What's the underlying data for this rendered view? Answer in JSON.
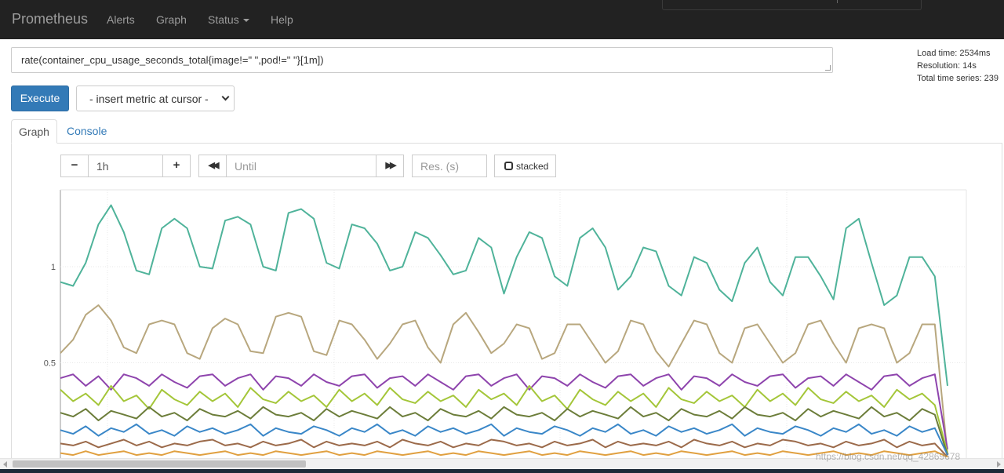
{
  "navbar": {
    "brand": "Prometheus",
    "links": [
      {
        "label": "Alerts"
      },
      {
        "label": "Graph"
      },
      {
        "label": "Status"
      },
      {
        "label": "Help"
      }
    ]
  },
  "query": {
    "expression": "rate(container_cpu_usage_seconds_total{image!=\" \",pod!=\" \"}[1m])"
  },
  "stats": {
    "load_time": "Load time: 2534ms",
    "resolution": "Resolution: 14s",
    "total_series": "Total time series: 239"
  },
  "actions": {
    "execute_label": "Execute",
    "insert_metric_label": "- insert metric at cursor -"
  },
  "tabs": [
    {
      "label": "Graph",
      "active": true
    },
    {
      "label": "Console",
      "active": false
    }
  ],
  "graph_controls": {
    "range_decrease": "−",
    "range_value": "1h",
    "range_increase": "+",
    "back": "◀◀",
    "until_placeholder": "Until",
    "forward": "▶▶",
    "resolution_placeholder": "Res. (s)",
    "stacked_label": "stacked"
  },
  "watermark": "https://blog.csdn.net/qq_42869678",
  "chart_data": {
    "type": "line",
    "ylim": [
      0,
      1.4
    ],
    "y_ticks": [
      {
        "value": 0.5,
        "label": "0.5"
      },
      {
        "value": 1,
        "label": "1"
      }
    ],
    "grid": true,
    "series_count_shown": 239,
    "colors": [
      "#4fb39a",
      "#b8a77e",
      "#8e44ad",
      "#a4c639",
      "#6c7d3a",
      "#3a87c8",
      "#9b6a4a",
      "#e0a040"
    ],
    "series": [
      {
        "values": [
          0.92,
          0.9,
          1.02,
          1.22,
          1.32,
          1.18,
          0.98,
          0.96,
          1.2,
          1.25,
          1.2,
          1.0,
          0.99,
          1.24,
          1.26,
          1.22,
          1.0,
          0.98,
          1.28,
          1.3,
          1.25,
          1.02,
          0.99,
          1.22,
          1.2,
          1.12,
          0.98,
          1.0,
          1.18,
          1.15,
          1.06,
          0.96,
          0.98,
          1.15,
          1.1,
          0.86,
          1.05,
          1.18,
          1.15,
          0.95,
          0.9,
          1.15,
          1.2,
          1.1,
          0.88,
          0.95,
          1.1,
          1.08,
          0.9,
          0.85,
          1.05,
          1.02,
          0.88,
          0.82,
          1.02,
          1.1,
          0.92,
          0.85,
          1.05,
          1.05,
          0.95,
          0.83,
          1.2,
          1.25,
          1.02,
          0.8,
          0.85,
          1.05,
          1.05,
          0.95,
          0.38
        ]
      },
      {
        "values": [
          0.55,
          0.62,
          0.75,
          0.8,
          0.72,
          0.58,
          0.55,
          0.7,
          0.72,
          0.7,
          0.55,
          0.52,
          0.68,
          0.73,
          0.7,
          0.56,
          0.55,
          0.74,
          0.76,
          0.74,
          0.56,
          0.54,
          0.72,
          0.7,
          0.62,
          0.52,
          0.6,
          0.7,
          0.72,
          0.58,
          0.5,
          0.7,
          0.76,
          0.66,
          0.55,
          0.6,
          0.7,
          0.68,
          0.52,
          0.55,
          0.7,
          0.7,
          0.6,
          0.5,
          0.56,
          0.72,
          0.7,
          0.56,
          0.48,
          0.6,
          0.72,
          0.7,
          0.55,
          0.5,
          0.68,
          0.7,
          0.6,
          0.5,
          0.55,
          0.7,
          0.72,
          0.6,
          0.5,
          0.68,
          0.7,
          0.68,
          0.5,
          0.55,
          0.7,
          0.7,
          0.02
        ]
      },
      {
        "values": [
          0.42,
          0.44,
          0.38,
          0.43,
          0.36,
          0.44,
          0.42,
          0.38,
          0.44,
          0.4,
          0.37,
          0.43,
          0.44,
          0.38,
          0.42,
          0.44,
          0.36,
          0.43,
          0.42,
          0.38,
          0.44,
          0.4,
          0.38,
          0.43,
          0.44,
          0.37,
          0.42,
          0.43,
          0.38,
          0.44,
          0.4,
          0.36,
          0.43,
          0.44,
          0.38,
          0.42,
          0.44,
          0.36,
          0.43,
          0.42,
          0.38,
          0.44,
          0.4,
          0.37,
          0.43,
          0.44,
          0.38,
          0.42,
          0.44,
          0.36,
          0.43,
          0.42,
          0.38,
          0.44,
          0.4,
          0.38,
          0.43,
          0.44,
          0.37,
          0.42,
          0.43,
          0.38,
          0.44,
          0.4,
          0.36,
          0.43,
          0.44,
          0.38,
          0.42,
          0.44,
          0.05
        ]
      },
      {
        "values": [
          0.36,
          0.3,
          0.34,
          0.28,
          0.38,
          0.3,
          0.33,
          0.26,
          0.36,
          0.31,
          0.28,
          0.35,
          0.3,
          0.34,
          0.27,
          0.37,
          0.31,
          0.29,
          0.35,
          0.3,
          0.33,
          0.27,
          0.36,
          0.3,
          0.34,
          0.28,
          0.37,
          0.31,
          0.29,
          0.35,
          0.3,
          0.33,
          0.27,
          0.36,
          0.31,
          0.34,
          0.28,
          0.38,
          0.3,
          0.33,
          0.26,
          0.36,
          0.31,
          0.28,
          0.35,
          0.3,
          0.34,
          0.27,
          0.37,
          0.31,
          0.29,
          0.35,
          0.3,
          0.33,
          0.27,
          0.36,
          0.3,
          0.34,
          0.28,
          0.37,
          0.31,
          0.29,
          0.35,
          0.3,
          0.33,
          0.27,
          0.36,
          0.31,
          0.34,
          0.28,
          0.03
        ]
      },
      {
        "values": [
          0.24,
          0.22,
          0.26,
          0.2,
          0.25,
          0.23,
          0.21,
          0.27,
          0.22,
          0.24,
          0.2,
          0.26,
          0.23,
          0.22,
          0.25,
          0.21,
          0.27,
          0.23,
          0.22,
          0.24,
          0.2,
          0.26,
          0.22,
          0.25,
          0.23,
          0.21,
          0.27,
          0.22,
          0.24,
          0.2,
          0.26,
          0.23,
          0.22,
          0.25,
          0.21,
          0.27,
          0.23,
          0.22,
          0.24,
          0.2,
          0.26,
          0.22,
          0.25,
          0.23,
          0.21,
          0.27,
          0.22,
          0.24,
          0.2,
          0.26,
          0.23,
          0.22,
          0.25,
          0.21,
          0.27,
          0.23,
          0.22,
          0.24,
          0.2,
          0.26,
          0.22,
          0.25,
          0.23,
          0.21,
          0.27,
          0.22,
          0.24,
          0.2,
          0.26,
          0.23,
          0.02
        ]
      },
      {
        "values": [
          0.15,
          0.13,
          0.17,
          0.12,
          0.16,
          0.14,
          0.18,
          0.13,
          0.15,
          0.12,
          0.17,
          0.14,
          0.16,
          0.13,
          0.15,
          0.18,
          0.12,
          0.16,
          0.14,
          0.13,
          0.17,
          0.15,
          0.12,
          0.16,
          0.14,
          0.18,
          0.13,
          0.15,
          0.12,
          0.17,
          0.14,
          0.16,
          0.13,
          0.15,
          0.18,
          0.12,
          0.16,
          0.14,
          0.13,
          0.17,
          0.15,
          0.12,
          0.16,
          0.14,
          0.18,
          0.13,
          0.15,
          0.12,
          0.17,
          0.14,
          0.16,
          0.13,
          0.15,
          0.18,
          0.12,
          0.16,
          0.14,
          0.13,
          0.17,
          0.15,
          0.12,
          0.16,
          0.14,
          0.18,
          0.13,
          0.15,
          0.12,
          0.17,
          0.14,
          0.16,
          0.02
        ]
      },
      {
        "values": [
          0.08,
          0.07,
          0.09,
          0.06,
          0.08,
          0.1,
          0.07,
          0.09,
          0.06,
          0.08,
          0.07,
          0.09,
          0.1,
          0.07,
          0.08,
          0.06,
          0.09,
          0.07,
          0.08,
          0.1,
          0.06,
          0.09,
          0.07,
          0.08,
          0.07,
          0.09,
          0.06,
          0.1,
          0.08,
          0.07,
          0.09,
          0.06,
          0.08,
          0.07,
          0.1,
          0.09,
          0.07,
          0.08,
          0.06,
          0.09,
          0.07,
          0.08,
          0.1,
          0.06,
          0.09,
          0.07,
          0.08,
          0.07,
          0.09,
          0.06,
          0.1,
          0.08,
          0.07,
          0.09,
          0.06,
          0.08,
          0.07,
          0.1,
          0.09,
          0.07,
          0.08,
          0.06,
          0.09,
          0.07,
          0.08,
          0.1,
          0.06,
          0.09,
          0.07,
          0.08,
          0.01
        ]
      },
      {
        "values": [
          0.03,
          0.02,
          0.04,
          0.02,
          0.03,
          0.04,
          0.02,
          0.03,
          0.02,
          0.04,
          0.03,
          0.02,
          0.03,
          0.04,
          0.02,
          0.03,
          0.02,
          0.04,
          0.03,
          0.02,
          0.03,
          0.04,
          0.02,
          0.03,
          0.02,
          0.04,
          0.03,
          0.02,
          0.03,
          0.04,
          0.02,
          0.03,
          0.02,
          0.04,
          0.03,
          0.02,
          0.03,
          0.04,
          0.02,
          0.03,
          0.02,
          0.04,
          0.03,
          0.02,
          0.03,
          0.04,
          0.02,
          0.03,
          0.02,
          0.04,
          0.03,
          0.02,
          0.03,
          0.04,
          0.02,
          0.03,
          0.02,
          0.04,
          0.03,
          0.02,
          0.03,
          0.04,
          0.02,
          0.03,
          0.02,
          0.04,
          0.03,
          0.02,
          0.03,
          0.04,
          0.01
        ]
      }
    ]
  }
}
